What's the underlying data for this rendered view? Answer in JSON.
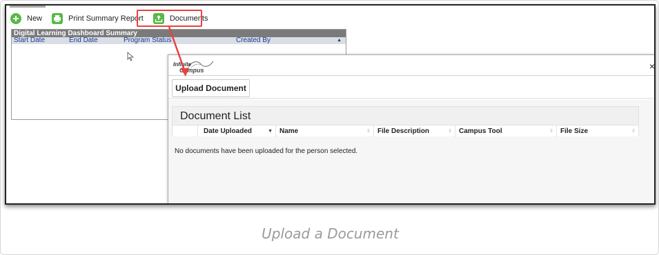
{
  "toolbar": {
    "new_label": "New",
    "print_label": "Print Summary Report",
    "documents_label": "Documents",
    "icons": [
      "plus-icon",
      "printer-icon",
      "upload-icon"
    ]
  },
  "summary": {
    "title": "Digital Learning Dashboard Summary",
    "columns": [
      "Start Date",
      "End Date",
      "Program Status",
      "Created By"
    ],
    "sort_indicator": "▲"
  },
  "modal": {
    "logo_line1": "Infinite",
    "logo_line2": "Campus",
    "close_label": "×",
    "upload_button": "Upload Document",
    "list_title": "Document List",
    "columns": [
      {
        "label": "Date Uploaded",
        "sort": "▼"
      },
      {
        "label": "Name",
        "sort": "⇳"
      },
      {
        "label": "File Description",
        "sort": "⇳"
      },
      {
        "label": "Campus Tool",
        "sort": "⇳"
      },
      {
        "label": "File Size",
        "sort": "⇳"
      }
    ],
    "empty_message": "No documents have been uploaded for the person selected."
  },
  "caption": "Upload a Document",
  "colors": {
    "accent_green": "#58b947",
    "highlight_red": "#e8413f",
    "header_gray": "#7a7a7a"
  }
}
